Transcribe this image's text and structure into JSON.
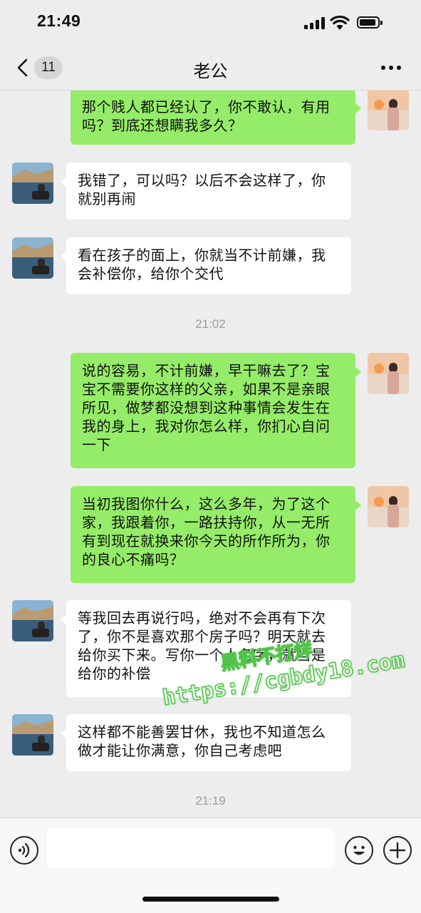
{
  "status_bar": {
    "time": "21:49"
  },
  "nav": {
    "back_badge": "11",
    "title": "老公"
  },
  "messages": [
    {
      "side": "out",
      "text": "那个贱人都已经认了，你不敢认，有用吗？到底还想瞒我多久？"
    },
    {
      "side": "in",
      "text": "我错了，可以吗？以后不会这样了，你就别再闹"
    },
    {
      "side": "in",
      "text": "看在孩子的面上，你就当不计前嫌，我会补偿你，给你个交代"
    },
    {
      "side": "out",
      "text": "说的容易，不计前嫌，早干嘛去了？宝宝不需要你这样的父亲，如果不是亲眼所见，做梦都没想到这种事情会发生在我的身上，我对你怎么样，你扪心自问一下"
    },
    {
      "side": "out",
      "text": "当初我图你什么，这么多年，为了这个家，我跟着你，一路扶持你，从一无所有到现在就换来你今天的所作所为，你的良心不痛吗？"
    },
    {
      "side": "in",
      "text": "等我回去再说行吗，绝对不会再有下次了，你不是喜欢那个房子吗？明天就去给你买下来。写你一个人名字，就当是给你的补偿"
    },
    {
      "side": "in",
      "text": "这样都不能善罢甘休，我也不知道怎么做才能让你满意，你自己考虑吧"
    }
  ],
  "timestamps": [
    "21:02",
    "21:19"
  ],
  "watermark": {
    "line1": "黑料不打烊",
    "line2": "https://cgbdy18.com"
  },
  "input": {
    "value": "",
    "placeholder": ""
  },
  "icons": {
    "back": "chevron-left-icon",
    "more": "more-dots-icon",
    "voice": "voice-icon",
    "emoji": "emoji-icon",
    "plus": "plus-icon"
  },
  "colors": {
    "outgoing_bubble": "#95ec69",
    "incoming_bubble": "#ffffff",
    "background": "#ededed"
  }
}
